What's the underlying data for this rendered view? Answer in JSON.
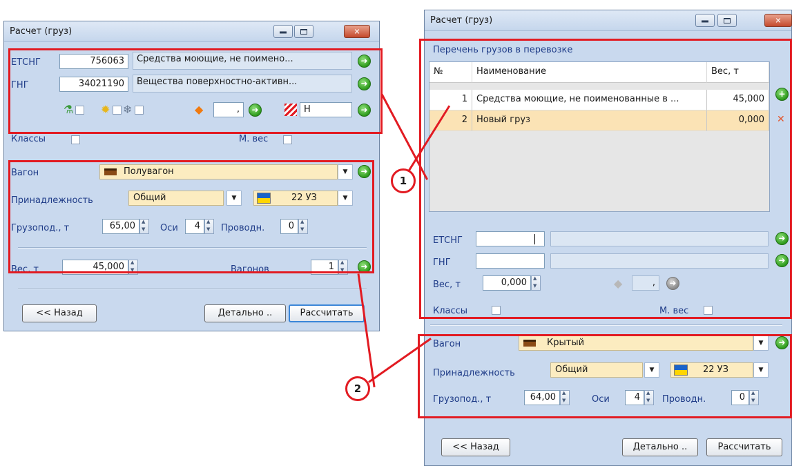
{
  "left_window": {
    "title": "Расчет (груз)",
    "etsng": {
      "label": "ЕТСНГ",
      "code": "756063",
      "name": "Средства моющие, не поимено..."
    },
    "gng": {
      "label": "ГНГ",
      "code": "34021190",
      "name": "Вещества поверхностно-активн..."
    },
    "special_value": ",",
    "hazard_value": "Н",
    "classes_label": "Классы",
    "mweight_label": "М. вес",
    "wagon": {
      "label": "Вагон",
      "value": "Полувагон"
    },
    "ownership": {
      "label": "Принадлежность",
      "value": "Общий",
      "country": "22  УЗ"
    },
    "capacity": {
      "label": "Грузопод., т",
      "value": "65,00"
    },
    "axles": {
      "label": "Оси",
      "value": "4"
    },
    "guides": {
      "label": "Проводн.",
      "value": "0"
    },
    "weight": {
      "label": "Вес, т",
      "value": "45,000"
    },
    "wagons": {
      "label": "Вагонов",
      "value": "1"
    },
    "back_button": "<< Назад",
    "detail_button": "Детально ..",
    "calc_button": "Рассчитать"
  },
  "right_window": {
    "title": "Расчет (груз)",
    "section_title": "Перечень грузов в перевозке",
    "columns": [
      "№",
      "Наименование",
      "Вес, т"
    ],
    "rows": [
      {
        "num": "1",
        "name": "Средства моющие, не поименованные в ...",
        "weight": "45,000"
      },
      {
        "num": "2",
        "name": "Новый груз",
        "weight": "0,000"
      }
    ],
    "etsng_label": "ЕТСНГ",
    "gng_label": "ГНГ",
    "weight": {
      "label": "Вес, т",
      "value": "0,000"
    },
    "special_value": ",",
    "classes_label": "Классы",
    "mweight_label": "М. вес",
    "wagon": {
      "label": "Вагон",
      "value": "Крытый"
    },
    "ownership": {
      "label": "Принадлежность",
      "value": "Общий",
      "country": "22  УЗ"
    },
    "capacity": {
      "label": "Грузопод., т",
      "value": "64,00"
    },
    "axles": {
      "label": "Оси",
      "value": "4"
    },
    "guides": {
      "label": "Проводн.",
      "value": "0"
    },
    "back_button": "<< Назад",
    "detail_button": "Детально ..",
    "calc_button": "Рассчитать"
  },
  "callouts": {
    "one": "1",
    "two": "2"
  },
  "colors": {
    "annotation_red": "#e21b22",
    "window_bg": "#c9d9ee",
    "combo_bg": "#fcecc0",
    "selected_row": "#fbe3b5"
  }
}
